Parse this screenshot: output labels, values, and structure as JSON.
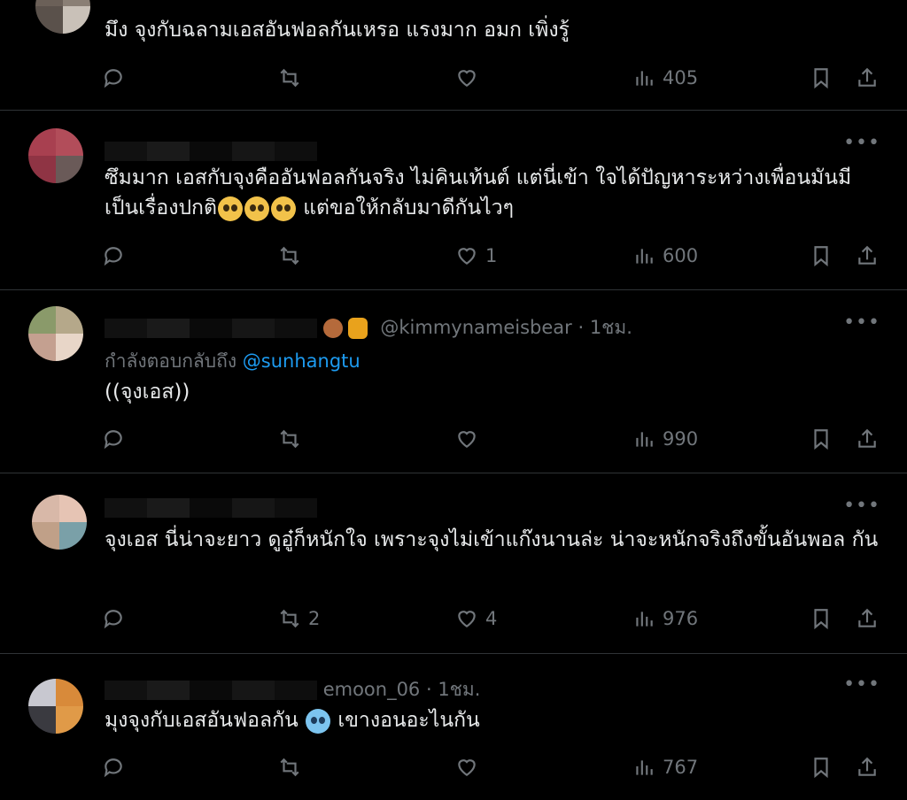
{
  "tweets": [
    {
      "handle": "",
      "text": "มึง จุงกับฉลามเอสอันฟอลกันเหรอ แรงมาก อมก เพิ่งรู้",
      "replies": "",
      "retweets": "",
      "likes": "",
      "views": "405"
    },
    {
      "handle": "",
      "text_before_emoji": "ซึมมาก เอสกับจุงคืออันฟอลกันจริง ไม่คินเท้นต์ แต่นี่เข้า ใจได้ปัญหาระหว่างเพื่อนมันมี เป็นเรื่องปกติ",
      "text_after_emoji": " แต่ขอให้กลับมาดีกันไวๆ",
      "replies": "",
      "retweets": "",
      "likes": "1",
      "views": "600"
    },
    {
      "handle": "@kimmynameisbear · 1ชม.",
      "replying_prefix": "กำลังตอบกลับถึง",
      "replying_mention": "@sunhangtu",
      "text": "((จุงเอส))",
      "replies": "",
      "retweets": "",
      "likes": "",
      "views": "990"
    },
    {
      "handle": "",
      "text": "จุงเอส นี่น่าจะยาว ดูอู๋ก็หนักใจ เพราะจุงไม่เข้าแก๊งนานล่ะ น่าจะหนักจริงถึงขั้นอันพอล กัน",
      "replies": "",
      "retweets": "2",
      "likes": "4",
      "views": "976"
    },
    {
      "handle": "emoon_06 · 1ชม.",
      "text_before_emoji": "มุงจุงกับเอสอันฟอลกัน",
      "text_after_emoji": " เขางอนอะไนกัน",
      "replies": "",
      "retweets": "",
      "likes": "",
      "views": "767"
    }
  ],
  "icons": {
    "reply": "reply-icon",
    "retweet": "retweet-icon",
    "like": "heart-icon",
    "views": "views-icon",
    "bookmark": "bookmark-icon",
    "share": "share-icon",
    "more": "more-icon"
  },
  "colors": {
    "background": "#000000",
    "text": "#e7e9ea",
    "muted": "#71767b",
    "link": "#1d9bf0",
    "divider": "#2f3336"
  }
}
